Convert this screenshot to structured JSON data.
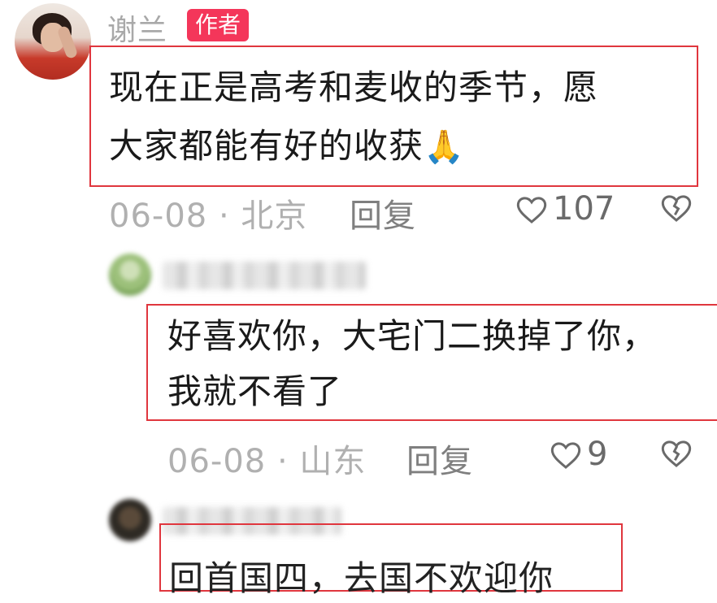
{
  "comments": [
    {
      "username": "谢兰",
      "badge": "作者",
      "text_line1": "现在正是高考和麦收的季节，愿",
      "text_line2": "大家都能有好的收获",
      "emoji": "🙏",
      "date": "06-08",
      "location": "北京",
      "reply_label": "回复",
      "likes": "107"
    },
    {
      "text_line1": "好喜欢你，大宅门二换掉了你，",
      "text_line2": "我就不看了",
      "date": "06-08",
      "location": "山东",
      "reply_label": "回复",
      "likes": "9"
    },
    {
      "text_line1": "回首国四，去国不欢迎你"
    }
  ],
  "colors": {
    "highlight_border": "#e0363e",
    "badge_bg": "#f4365a",
    "meta_text": "#b0b0b0"
  }
}
